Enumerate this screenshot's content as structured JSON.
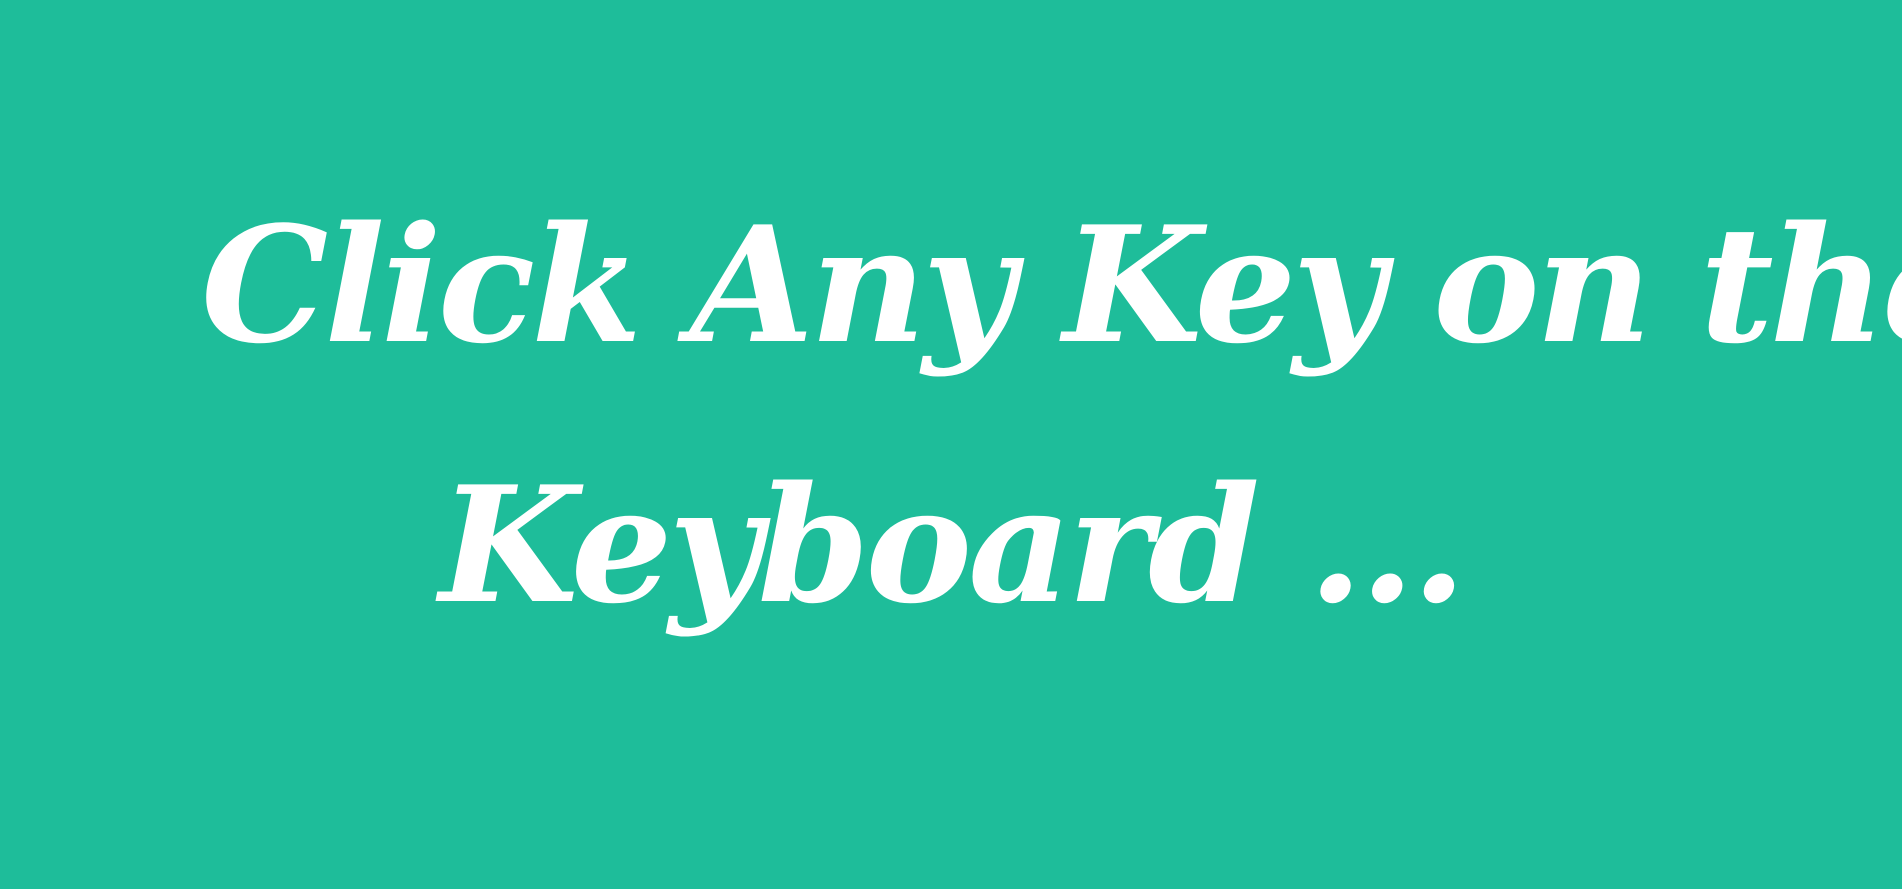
{
  "colors": {
    "background": "#1ebd9a",
    "text": "#ffffff"
  },
  "prompt": {
    "line1": "Click Any Key on the",
    "line2": "Keyboard ..."
  }
}
